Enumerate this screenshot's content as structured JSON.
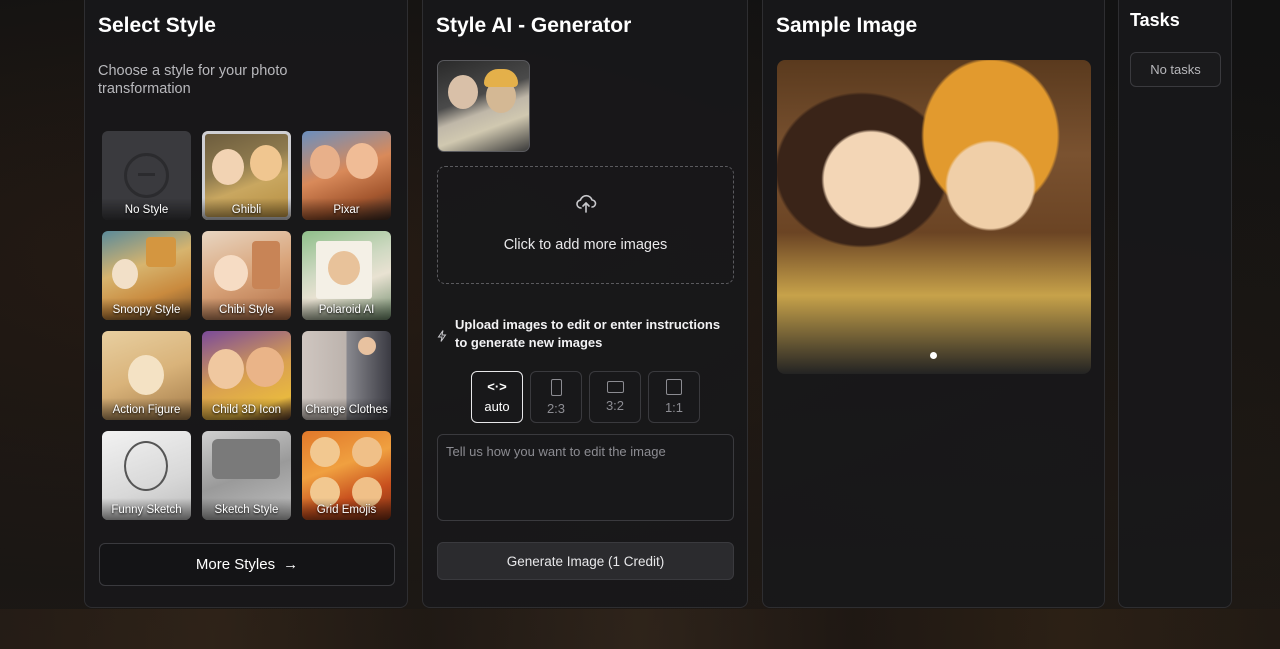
{
  "select_style": {
    "title": "Select Style",
    "subtitle": "Choose a style for your photo transformation",
    "styles": [
      {
        "label": "No Style",
        "selected": false
      },
      {
        "label": "Ghibli",
        "selected": true
      },
      {
        "label": "Pixar",
        "selected": false
      },
      {
        "label": "Snoopy Style",
        "selected": false
      },
      {
        "label": "Chibi Style",
        "selected": false
      },
      {
        "label": "Polaroid AI",
        "selected": false
      },
      {
        "label": "Action Figure",
        "selected": false
      },
      {
        "label": "Child 3D Icon",
        "selected": false
      },
      {
        "label": "Change Clothes",
        "selected": false
      },
      {
        "label": "Funny Sketch",
        "selected": false
      },
      {
        "label": "Sketch Style",
        "selected": false
      },
      {
        "label": "Grid Emojis",
        "selected": false
      }
    ],
    "more_button": "More Styles",
    "more_icon": "→"
  },
  "generator": {
    "title": "Style AI - Generator",
    "dropzone_label": "Click to add more images",
    "hint": "Upload images to edit or enter instructions to generate new images",
    "ratios": [
      {
        "label": "auto",
        "symbol": "<·>",
        "active": true
      },
      {
        "label": "2:3",
        "active": false
      },
      {
        "label": "3:2",
        "active": false
      },
      {
        "label": "1:1",
        "active": false
      }
    ],
    "prompt_placeholder": "Tell us how you want to edit the image",
    "generate_button": "Generate Image (1 Credit)"
  },
  "sample": {
    "title": "Sample Image"
  },
  "tasks": {
    "title": "Tasks",
    "empty": "No tasks"
  }
}
